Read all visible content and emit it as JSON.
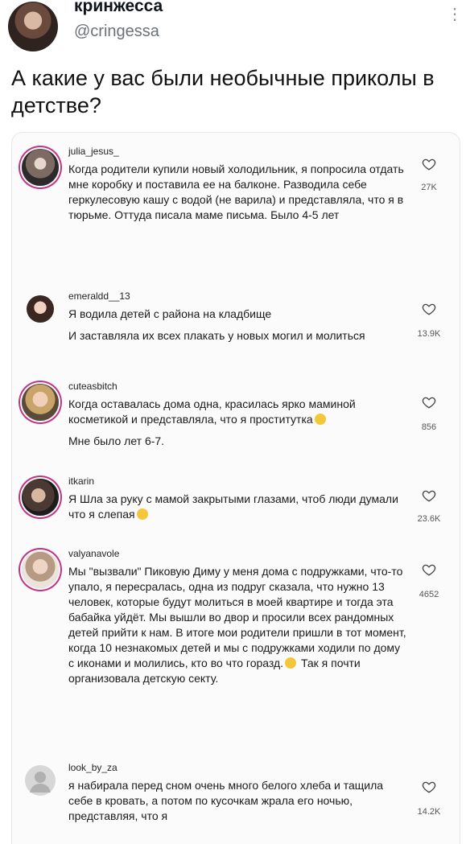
{
  "author": {
    "display_name": "кринжесса",
    "handle": "@cringessa"
  },
  "tweet": {
    "text": "А какие у вас были необычные приколы в детстве?"
  },
  "comments": [
    {
      "username": "julia_jesus_",
      "lines": [
        "Когда родители купили новый холодильник, я попросила отдать мне коробку и поставила ее на балконе. Разводила себе геркулесовую кашу с водой (не варила) и представляла, что я в тюрьме. Оттуда писала маме письма. Было 4-5 лет"
      ],
      "likes": "27K"
    },
    {
      "username": "emeraldd__13",
      "lines": [
        "Я водила детей с района на кладбище",
        "И заставляла их всех плакать у новых могил и молиться"
      ],
      "likes": "13.9K"
    },
    {
      "username": "cuteasbitch",
      "lines": [
        "Когда оставалась дома одна, красилась ярко маминой косметикой и представляла, что я проститутка",
        "Мне было лет 6-7."
      ],
      "likes": "856"
    },
    {
      "username": "itkarin",
      "lines": [
        "Я Шла за руку с мамой закрытыми глазами, чтоб люди думали что я слепая"
      ],
      "likes": "23.6K"
    },
    {
      "username": "valyanavole",
      "lines": [
        "Мы \"вызвали\" Пиковую Диму у меня дома с подружками, что-то упало, я пересралась, одна из подруг сказала, что нужно 13 человек, которые будут молиться в моей квартире и тогда эта бабайка уйдёт. Мы вышли во двор и просили всех рандомных детей прийти к нам. В итоге мои родители пришли в тот момент, когда 10 незнакомых детей и мы с подружками ходили по дому с иконами и молились, кто во что горазд.",
        "Так я почти организовала детскую секту."
      ],
      "likes": "4652"
    },
    {
      "username": "look_by_za",
      "lines": [
        "я набирала перед сном очень много белого хлеба и тащила себе в кровать, а потом по кусочкам жрала его ночью, представляя, что я"
      ],
      "likes": "14.2K"
    }
  ],
  "icons": {
    "like": "heart-outline-icon",
    "more": "more-vertical-icon"
  },
  "colors": {
    "story_ring": "#c13584",
    "muted": "#6b7177"
  }
}
